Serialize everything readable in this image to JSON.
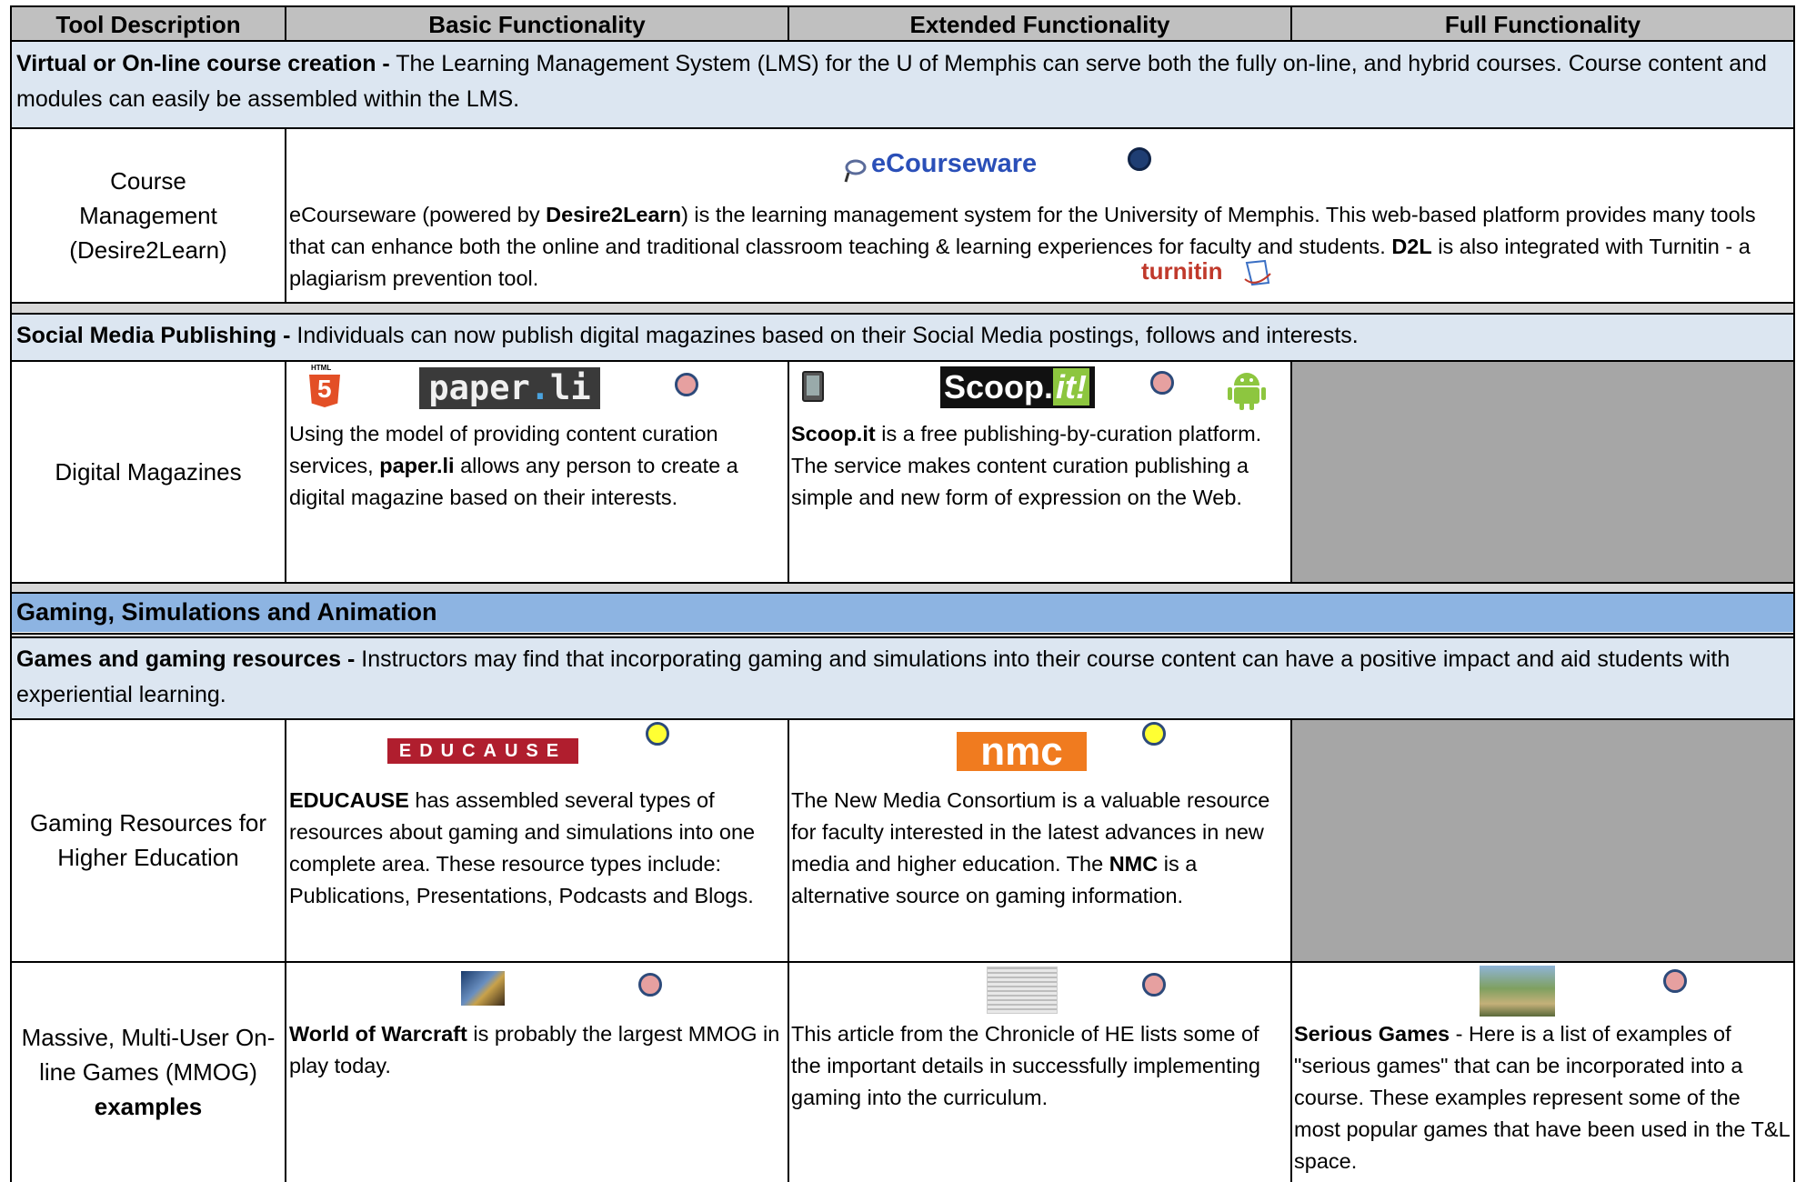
{
  "header": {
    "col1": "Tool Description",
    "col2": "Basic Functionality",
    "col3": "Extended Functionality",
    "col4": "Full Functionality"
  },
  "virtual": {
    "title": "Virtual or On-line course creation -",
    "text": " The Learning Management System (LMS) for the U of Memphis can serve both the fully on-line, and hybrid courses.  Course content and modules can easily be assembled within the LMS."
  },
  "course_mgmt": {
    "tool": "Course Management (Desire2Learn)",
    "logo": "eCourseware",
    "turnitin_logo": "turnitin",
    "t1": "eCourseware (powered by ",
    "b1": "Desire2Learn",
    "t2": ") is the learning management system for the University of Memphis. This web-based platform provides many tools that can enhance both the online and traditional classroom teaching & learning experiences for faculty and students.  ",
    "b2": "D2L",
    "t3": " is also integrated with Turnitin - a plagiarism prevention tool."
  },
  "social": {
    "title": "Social Media Publishing -",
    "text": " Individuals can now publish digital magazines based on their Social Media postings, follows and interests."
  },
  "digital_mag": {
    "tool": "Digital Magazines",
    "paper_logo_a": "paper",
    "paper_logo_b": ".",
    "paper_logo_c": "li",
    "html5_label": "HTML",
    "html5_num": "5",
    "basic_t1": "Using the model of providing content curation services, ",
    "basic_b": "paper.li",
    "basic_t2": " allows any person to create a digital magazine based on their interests.",
    "scoop_logo_a": "Scoop.",
    "scoop_logo_b": "it!",
    "ext_b": "Scoop.it",
    "ext_t": " is a free publishing-by-curation platform. The service makes content curation publishing a simple and new form of expression on the Web."
  },
  "gaming": {
    "category": "Gaming, Simulations and Animation",
    "title": "Games and gaming resources -",
    "text": " Instructors may find that incorporating gaming and simulations into their course content can have a positive impact and aid students with experiential learning."
  },
  "gaming_resources": {
    "tool": "Gaming Resources for Higher Education",
    "educause_logo": "EDUCAUSE",
    "basic_b": "EDUCAUSE",
    "basic_t": " has assembled several types of resources about gaming and simulations into one complete area.  These resource types include: Publications, Presentations, Podcasts and Blogs.",
    "nmc_logo": "nmc",
    "ext_t1": "The New Media Consortium is a valuable resource for faculty interested in the latest advances in new media and higher education.  The ",
    "ext_b": "NMC",
    "ext_t2": " is a alternative source on gaming information."
  },
  "mmog": {
    "tool": "Massive, Multi-User On-line Games (MMOG)",
    "tool_bold": "examples",
    "basic_b": "World of Warcraft",
    "basic_t": " is probably the largest MMOG in play today.",
    "ext_t": "This article from the Chronicle of HE lists some of the important details in successfully implementing gaming into the curriculum.",
    "full_b": "Serious Games",
    "full_t": " - Here is a list of examples of \"serious games\" that can be incorporated into a course.  These examples represent some of the most popular games that have been used in the T&L space."
  },
  "colors": {
    "header_bg": "#c0c0c0",
    "band_bg": "#dce6f1",
    "category_bg": "#8db4e2",
    "empty_cell": "#a6a6a6"
  }
}
